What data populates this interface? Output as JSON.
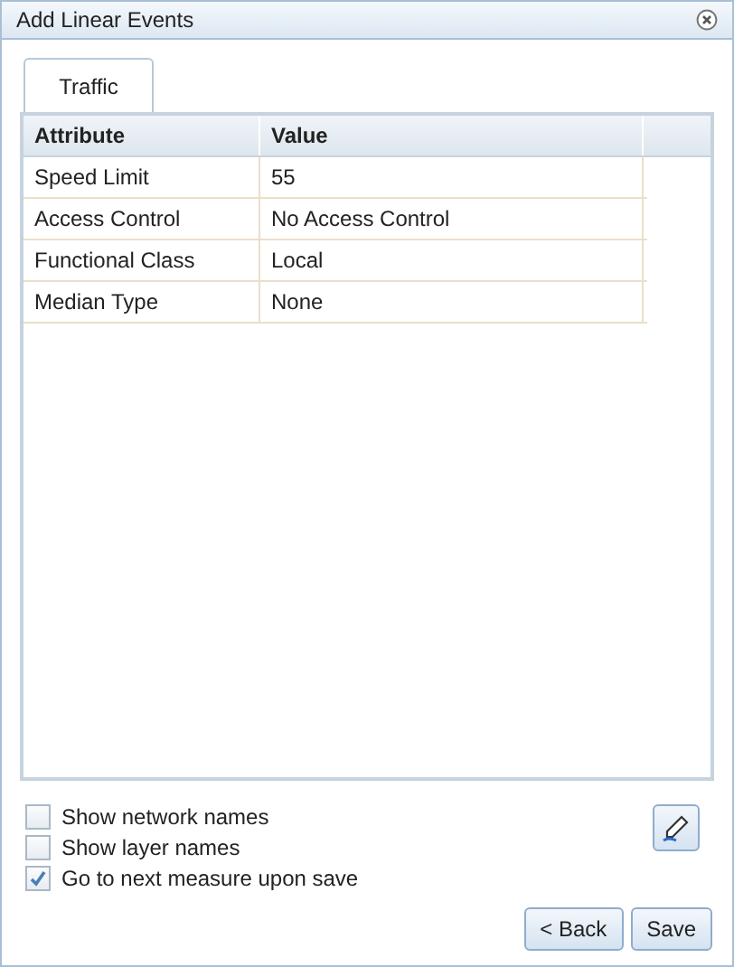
{
  "window": {
    "title": "Add Linear Events"
  },
  "tabs": [
    {
      "label": "Traffic",
      "selected": true
    }
  ],
  "table": {
    "columns": [
      "Attribute",
      "Value"
    ],
    "rows": [
      [
        "Speed Limit",
        "55"
      ],
      [
        "Access Control",
        "No Access Control"
      ],
      [
        "Functional Class",
        "Local"
      ],
      [
        "Median Type",
        "None"
      ]
    ]
  },
  "options": [
    {
      "label": "Show network names",
      "checked": false
    },
    {
      "label": "Show layer names",
      "checked": false
    },
    {
      "label": "Go to next measure upon save",
      "checked": true
    }
  ],
  "buttons": [
    "< Back",
    "Save"
  ]
}
